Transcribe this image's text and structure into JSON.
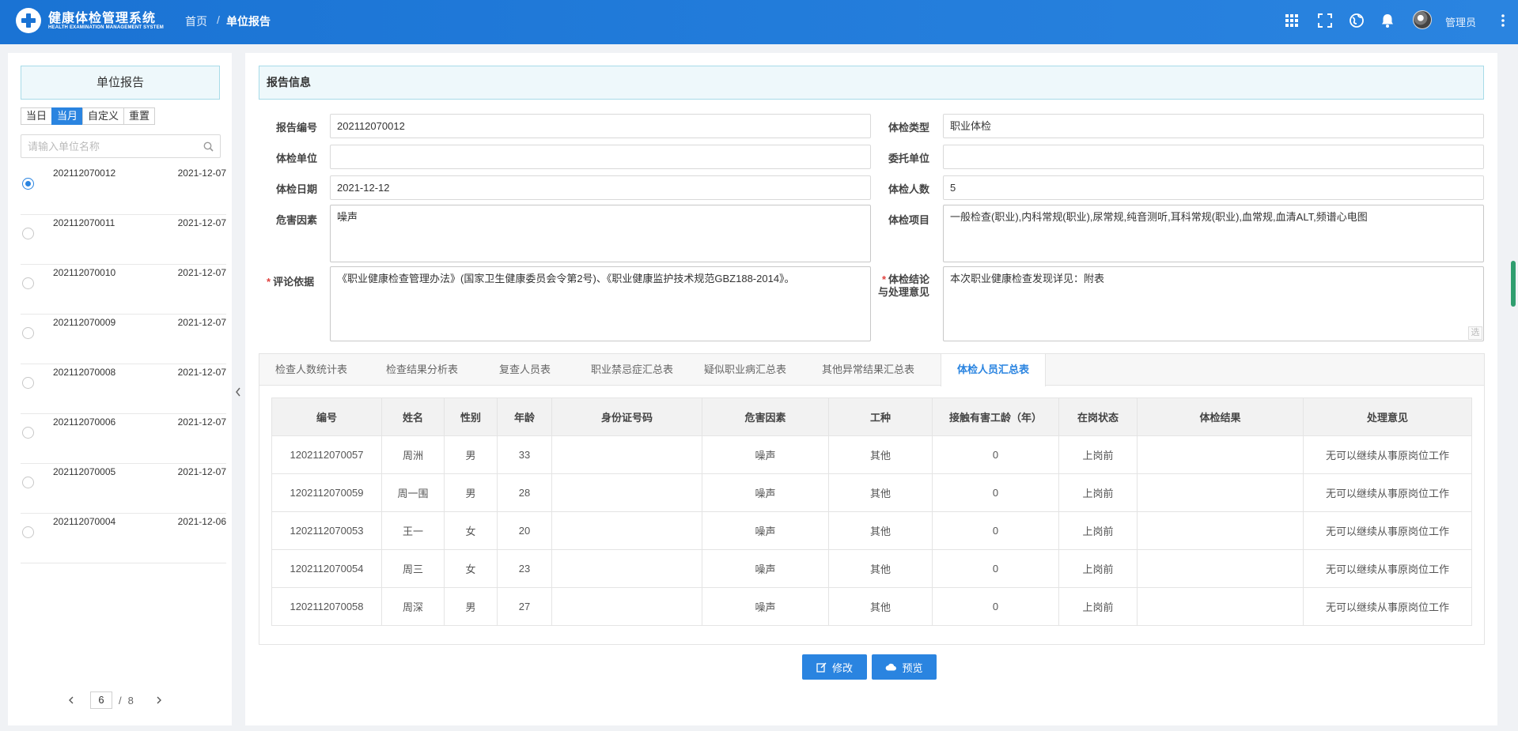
{
  "app": {
    "title": "健康体检管理系统",
    "subtitle": "HEALTH EXAMINATION MANAGEMENT SYSTEM"
  },
  "breadcrumb": {
    "home": "首页",
    "separator": "/",
    "current": "单位报告"
  },
  "header": {
    "icons": [
      "apps-icon",
      "fullscreen-icon",
      "globe-icon",
      "bell-icon",
      "avatar",
      "more-icon"
    ],
    "user_name": "管理员"
  },
  "left_panel": {
    "title": "单位报告",
    "filters": [
      "当日",
      "当月",
      "自定义",
      "重置"
    ],
    "active_filter": "当月",
    "search_placeholder": "请输入单位名称",
    "reports": [
      {
        "no": "202112070012",
        "date": "2021-12-07",
        "selected": true
      },
      {
        "no": "202112070011",
        "date": "2021-12-07",
        "selected": false
      },
      {
        "no": "202112070010",
        "date": "2021-12-07",
        "selected": false
      },
      {
        "no": "202112070009",
        "date": "2021-12-07",
        "selected": false
      },
      {
        "no": "202112070008",
        "date": "2021-12-07",
        "selected": false
      },
      {
        "no": "202112070006",
        "date": "2021-12-07",
        "selected": false
      },
      {
        "no": "202112070005",
        "date": "2021-12-07",
        "selected": false
      },
      {
        "no": "202112070004",
        "date": "2021-12-06",
        "selected": false
      }
    ],
    "pager": {
      "current": "6",
      "separator": "/",
      "total": "8"
    }
  },
  "report_info": {
    "title": "报告信息",
    "fields": {
      "report_no": {
        "label": "报告编号",
        "value": "202112070012"
      },
      "exam_type": {
        "label": "体检类型",
        "value": "职业体检"
      },
      "exam_unit": {
        "label": "体检单位",
        "value": ""
      },
      "entrust_unit": {
        "label": "委托单位",
        "value": ""
      },
      "exam_date": {
        "label": "体检日期",
        "value": "2021-12-12"
      },
      "exam_count": {
        "label": "体检人数",
        "value": "5"
      },
      "hazard": {
        "label": "危害因素",
        "value": "噪声"
      },
      "exam_items": {
        "label": "体检项目",
        "value": "一般检查(职业),内科常规(职业),尿常规,纯音测听,耳科常规(职业),血常规,血清ALT,频谱心电图"
      },
      "basis": {
        "label": "评论依据",
        "value": "《职业健康检查管理办法》(国家卫生健康委员会令第2号)、《职业健康监护技术规范GBZ188-2014》。"
      },
      "conclusion": {
        "label_line1": "体检结论",
        "label_line2": "与处理意见",
        "value": "本次职业健康检查发现详见：附表",
        "pick": "选"
      }
    }
  },
  "tabs": [
    {
      "label": "检查人数统计表",
      "active": false
    },
    {
      "label": "检查结果分析表",
      "active": false
    },
    {
      "label": "复查人员表",
      "active": false
    },
    {
      "label": "职业禁忌症汇总表",
      "active": false
    },
    {
      "label": "疑似职业病汇总表",
      "active": false
    },
    {
      "label": "其他异常结果汇总表",
      "active": false
    },
    {
      "label": "体检人员汇总表",
      "active": true
    }
  ],
  "table": {
    "columns": [
      "编号",
      "姓名",
      "性别",
      "年龄",
      "身份证号码",
      "危害因素",
      "工种",
      "接触有害工龄（年）",
      "在岗状态",
      "体检结果",
      "处理意见"
    ],
    "rows": [
      [
        "1202112070057",
        "周洲",
        "男",
        "33",
        "",
        "噪声",
        "其他",
        "0",
        "上岗前",
        "",
        "无可以继续从事原岗位工作"
      ],
      [
        "1202112070059",
        "周一围",
        "男",
        "28",
        "",
        "噪声",
        "其他",
        "0",
        "上岗前",
        "",
        "无可以继续从事原岗位工作"
      ],
      [
        "1202112070053",
        "王一",
        "女",
        "20",
        "",
        "噪声",
        "其他",
        "0",
        "上岗前",
        "",
        "无可以继续从事原岗位工作"
      ],
      [
        "1202112070054",
        "周三",
        "女",
        "23",
        "",
        "噪声",
        "其他",
        "0",
        "上岗前",
        "",
        "无可以继续从事原岗位工作"
      ],
      [
        "1202112070058",
        "周深",
        "男",
        "27",
        "",
        "噪声",
        "其他",
        "0",
        "上岗前",
        "",
        "无可以继续从事原岗位工作"
      ]
    ]
  },
  "actions": {
    "edit": "修改",
    "preview": "预览"
  },
  "colors": {
    "primary": "#2a84e0",
    "header_bg": "#1a73d4",
    "required": "#e0413e"
  }
}
